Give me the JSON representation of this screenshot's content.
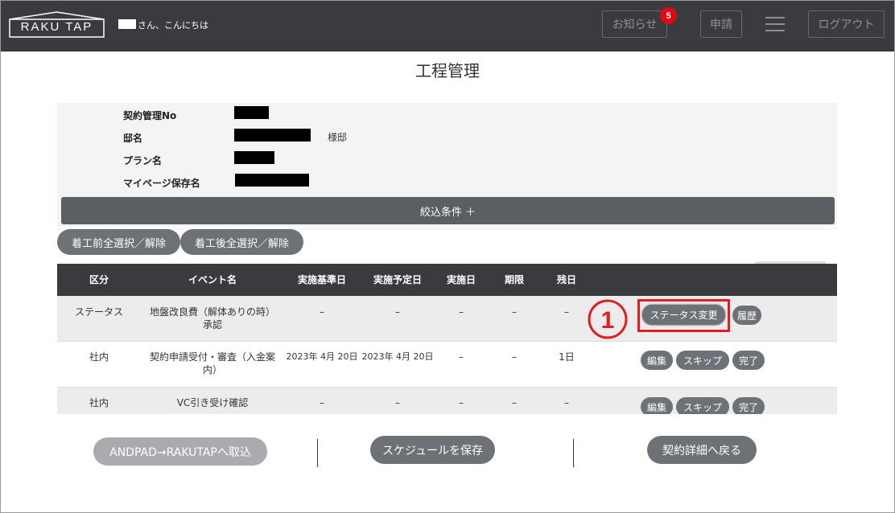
{
  "header": {
    "logo_text": "RAKU TAP",
    "greeting": "さん、こんにちは",
    "notice_label": "お知らせ",
    "notice_badge": "5",
    "apply_label": "申請",
    "logout_label": "ログアウト"
  },
  "page": {
    "title": "工程管理"
  },
  "info": {
    "contract_no_label": "契約管理No",
    "residence_label": "邸名",
    "residence_suffix": "様邸",
    "plan_label": "プラン名",
    "mypage_label": "マイページ保存名"
  },
  "filter": {
    "label": "絞込条件 ＋"
  },
  "select": {
    "before_label": "着工前全選択／解除",
    "after_label": "着工後全選択／解除"
  },
  "table": {
    "headers": [
      "区分",
      "イベント名",
      "実施基準日",
      "実施予定日",
      "実施日",
      "期限",
      "残日"
    ],
    "rows": [
      {
        "category": "ステータス",
        "event_line1": "地盤改良費（解体ありの時）",
        "event_line2": "承認",
        "base_date": "–",
        "planned_date": "–",
        "done_date": "–",
        "deadline": "–",
        "remaining": "–",
        "actions": [
          "ステータス変更",
          "履歴"
        ]
      },
      {
        "category": "社内",
        "event_line1": "契約申請受付・審査（入金案",
        "event_line2": "内）",
        "base_date": "2023年 4月 20日",
        "planned_date": "2023年 4月 20日",
        "done_date": "–",
        "deadline": "–",
        "remaining": "1日",
        "actions": [
          "編集",
          "スキップ",
          "完了"
        ]
      },
      {
        "category": "社内",
        "event_line1": "VC引き受け確認",
        "event_line2": "",
        "base_date": "–",
        "planned_date": "–",
        "done_date": "–",
        "deadline": "–",
        "remaining": "–",
        "actions": [
          "編集",
          "スキップ",
          "完了"
        ]
      }
    ]
  },
  "annotation": {
    "number": "1",
    "color": "#e01e22"
  },
  "footer": {
    "andpad_label": "ANDPAD→RAKUTAPへ取込",
    "save_label": "スケジュールを保存",
    "back_label": "契約詳細へ戻る"
  },
  "colors": {
    "header_bg": "#3a3b3f",
    "button_bg": "#6e7176",
    "badge": "#e10a14",
    "highlight": "#e01e22"
  }
}
